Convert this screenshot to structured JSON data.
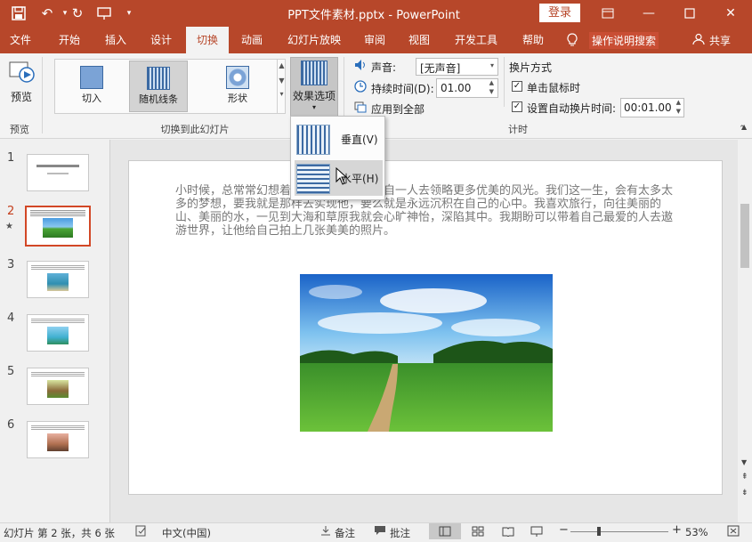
{
  "title_bar": {
    "title": "PPT文件素材.pptx  -  PowerPoint",
    "login_label": "登录"
  },
  "tabs": [
    {
      "label": "文件"
    },
    {
      "label": "开始"
    },
    {
      "label": "插入"
    },
    {
      "label": "设计"
    },
    {
      "label": "切换",
      "active": true
    },
    {
      "label": "动画"
    },
    {
      "label": "幻灯片放映"
    },
    {
      "label": "审阅"
    },
    {
      "label": "视图"
    },
    {
      "label": "开发工具"
    },
    {
      "label": "帮助"
    }
  ],
  "tell_me": "操作说明搜索",
  "share": "共享",
  "ribbon": {
    "preview_label": "预览",
    "preview_group": "预览",
    "transitions": [
      {
        "label": "切入"
      },
      {
        "label": "随机线条",
        "selected": true
      },
      {
        "label": "形状"
      }
    ],
    "effect_options_label": "效果选项",
    "transition_group": "切换到此幻灯片",
    "sound_label": "声音:",
    "sound_value": "[无声音]",
    "duration_label": "持续时间(D):",
    "duration_value": "01.00",
    "apply_all_label": "应用到全部",
    "advance_title": "换片方式",
    "on_click_label": "单击鼠标时",
    "after_label": "设置自动换片时间:",
    "after_value": "00:01.00",
    "timing_group": "计时"
  },
  "dropdown": {
    "items": [
      {
        "label": "垂直(V)"
      },
      {
        "label": "水平(H)",
        "hovered": true
      }
    ]
  },
  "thumbnails": [
    {
      "num": "1"
    },
    {
      "num": "2",
      "selected": true,
      "star": "★"
    },
    {
      "num": "3"
    },
    {
      "num": "4"
    },
    {
      "num": "5"
    },
    {
      "num": "6"
    }
  ],
  "slide": {
    "text": "小时候，总常常幻想着，长大以后可以独自一人去领略更多优美的风光。我们这一生，会有太多太多的梦想，要我就是那样去实现他，要么就是永远沉积在自己的心中。我喜欢旅行，向往美丽的山、美丽的水，一见到大海和草原我就会心旷神怡，深陷其中。我期盼可以带着自己最爱的人去遨游世界，让他给自己拍上几张美美的照片。"
  },
  "status": {
    "slide_info": "幻灯片 第 2 张，共 6 张",
    "language": "中文(中国)",
    "notes": "备注",
    "comments": "批注",
    "zoom": "53%"
  },
  "colors": {
    "accent": "#b7472a",
    "selection": "#d24726"
  }
}
